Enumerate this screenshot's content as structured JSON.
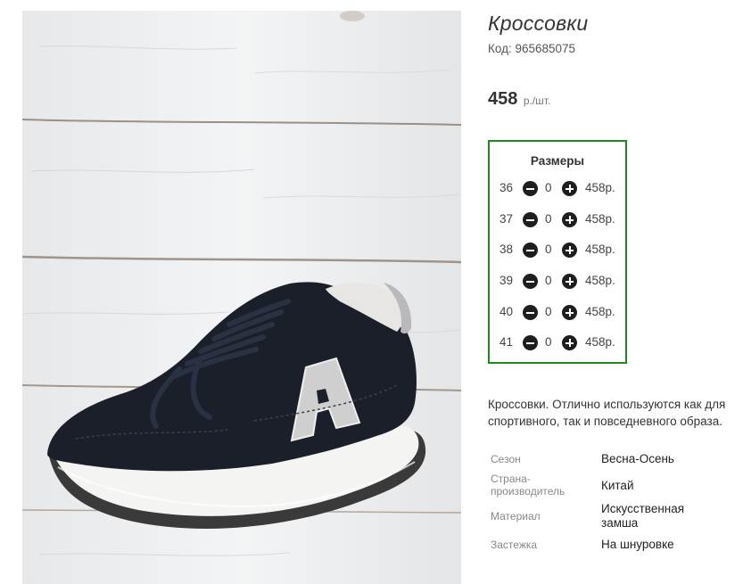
{
  "product": {
    "title": "Кроссовки",
    "code_label": "Код:",
    "code_value": "965685075",
    "price": "458",
    "price_unit": "р./шт."
  },
  "sizes": {
    "title": "Размеры",
    "rows": [
      {
        "size": "36",
        "qty": "0",
        "price": "458р."
      },
      {
        "size": "37",
        "qty": "0",
        "price": "458р."
      },
      {
        "size": "38",
        "qty": "0",
        "price": "458р."
      },
      {
        "size": "39",
        "qty": "0",
        "price": "458р."
      },
      {
        "size": "40",
        "qty": "0",
        "price": "458р."
      },
      {
        "size": "41",
        "qty": "0",
        "price": "458р."
      }
    ]
  },
  "description": "Кроссовки. Отлично используются как для спортивного, так и повседневного образа.",
  "specs": [
    {
      "label": "Сезон",
      "value": "Весна-Осень"
    },
    {
      "label": "Страна-производитель",
      "value": "Китай"
    },
    {
      "label": "Материал",
      "value": "Искусственная замша"
    },
    {
      "label": "Застежка",
      "value": "На шнуровке"
    }
  ],
  "colors": {
    "accent_border": "#1d8a1d",
    "button": "#1e1e1e"
  },
  "icons": [
    "minus-circle-icon",
    "plus-circle-icon"
  ]
}
